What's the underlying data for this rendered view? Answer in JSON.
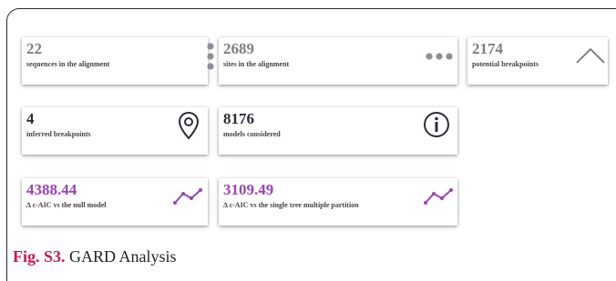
{
  "cards": [
    {
      "value": "22",
      "label": "sequences in the alignment",
      "icon": "vertical-ellipsis-icon"
    },
    {
      "value": "2689",
      "label": "sites in the alignment",
      "icon": "horizontal-ellipsis-icon"
    },
    {
      "value": "2174",
      "label": "potential breakpoints",
      "icon": "chevron-up-icon"
    },
    {
      "value": "4",
      "label": "inferred breakpoints",
      "icon": "map-pin-icon"
    },
    {
      "value": "8176",
      "label": "models considered",
      "icon": "info-icon"
    },
    {
      "value": "4388.44",
      "label": "Δ c-AIC vs the null model",
      "icon": "trend-line-icon"
    },
    {
      "value": "3109.49",
      "label": "Δ c-AIC vs the single tree multiple partition",
      "icon": "trend-line-icon"
    }
  ],
  "caption": {
    "fig": "Fig. S3.",
    "text": " GARD Analysis"
  },
  "colors": {
    "grey_value": "#7f7f7f",
    "dark_value": "#2a2e3a",
    "accent_purple": "#9a44b6",
    "caption_fig": "#c2185b"
  }
}
